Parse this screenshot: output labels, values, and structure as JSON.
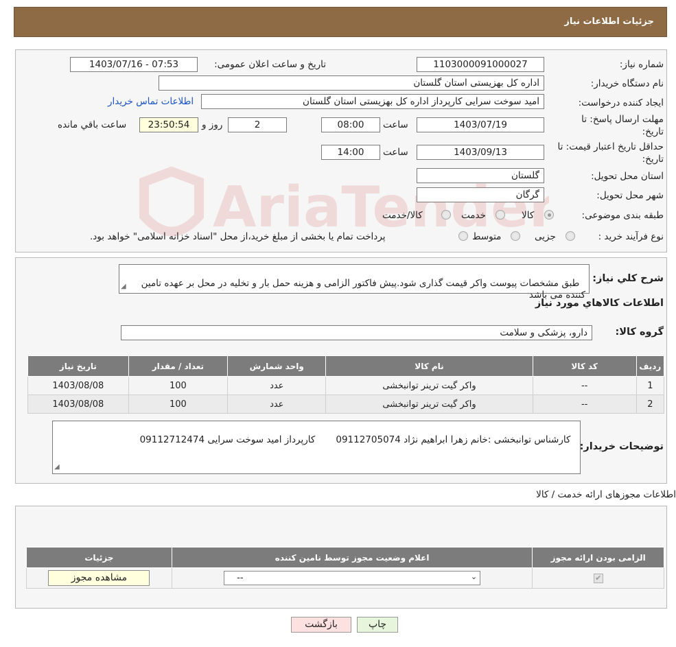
{
  "header": {
    "title": "جزئیات اطلاعات نیاز"
  },
  "watermark": {
    "text": "AriaTender.neT"
  },
  "form": {
    "need_number_label": "شماره نیاز:",
    "need_number": "1103000091000027",
    "announce_label": "تاریخ و ساعت اعلان عمومی:",
    "announce_value": "1403/07/16 - 07:53",
    "buyer_org_label": "نام دستگاه خریدار:",
    "buyer_org": "اداره کل بهزیستی استان گلستان",
    "requester_label": "ایجاد کننده درخواست:",
    "requester": "امید  سوخت سرایی کارپرداز اداره کل بهزیستی استان گلستان",
    "contact_link": "اطلاعات تماس خریدار",
    "deadline_label_1": "مهلت ارسال پاسخ: تا",
    "deadline_label_2": "تاریخ:",
    "deadline_date": "1403/07/19",
    "time_label": "ساعت",
    "deadline_time": "08:00",
    "days_value": "2",
    "days_label": "روز و",
    "remaining_time": "23:50:54",
    "remaining_label": "ساعت باقي مانده",
    "validity_label_1": "حداقل تاریخ اعتبار قیمت: تا",
    "validity_label_2": "تاریخ:",
    "validity_date": "1403/09/13",
    "validity_time": "14:00",
    "province_label": "استان محل تحویل:",
    "province": "گلستان",
    "city_label": "شهر محل تحویل:",
    "city": "گرگان",
    "category_label": "طبقه بندی موضوعی:",
    "category_options": [
      "کالا",
      "خدمت",
      "کالا/خدمت"
    ],
    "category_selected": 0,
    "process_label": "نوع فرآیند خرید :",
    "process_options": [
      "جزیی",
      "متوسط"
    ],
    "process_note": "پرداخت تمام یا بخشی از مبلغ خرید،از محل \"اسناد خزانه اسلامی\" خواهد بود."
  },
  "details": {
    "desc_label": "شرح کلي نياز:",
    "desc_text": "طبق مشخصات پیوست واکر قیمت گذاری شود.پیش فاکتور الزامی و هزینه حمل بار و تخلیه در محل بر عهده تامین کننده می باشد",
    "goods_info_title": "اطلاعات کالاهاي مورد نياز",
    "goods_group_label": "گروه کالا:",
    "goods_group": "دارو، پزشکی و سلامت",
    "table_headers": [
      "رديف",
      "کد کالا",
      "نام کالا",
      "واحد شمارش",
      "تعداد / مقدار",
      "تاریخ نیاز"
    ],
    "rows": [
      {
        "row": "1",
        "code": "--",
        "name": "واکر گیت ترینر توانبخشی",
        "unit": "عدد",
        "qty": "100",
        "date": "1403/08/08"
      },
      {
        "row": "2",
        "code": "--",
        "name": "واکر گیت ترینر توانبخشی",
        "unit": "عدد",
        "qty": "100",
        "date": "1403/08/08"
      }
    ],
    "buyer_notes_label": "توضیحات خریدار:",
    "buyer_notes": "کارشناس توانبخشی :خانم زهرا ابراهیم نژاد 09112705074       کارپرداز امید سوخت سرایی 09112712474"
  },
  "permits": {
    "title": "اطلاعات مجوزهای ارائه خدمت / کالا",
    "headers": [
      "الزامی بودن ارائه مجوز",
      "اعلام وضعیت مجوز توسط نامین کننده",
      "جزئیات"
    ],
    "select_value": "--",
    "view_button": "مشاهده مجوز"
  },
  "buttons": {
    "print": "چاپ",
    "back": "بازگشت"
  },
  "colors": {
    "header_bg": "#8e6b45",
    "table_header_bg": "#7c7c7c",
    "back_btn_bg": "#fde0e0",
    "print_btn_bg": "#e6f5dc"
  }
}
